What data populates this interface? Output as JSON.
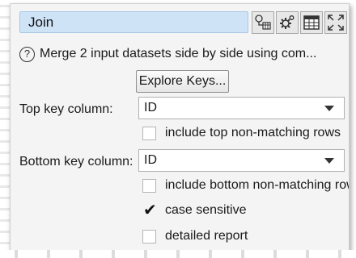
{
  "node": {
    "title": "Join",
    "description": "Merge 2 input datasets side by side using com...",
    "toolbar": {
      "icons": [
        "node-settings-icon",
        "gear-icon",
        "table-icon",
        "expand-icon"
      ]
    }
  },
  "explore_button": {
    "label": "Explore Keys..."
  },
  "top_key": {
    "label": "Top key column:",
    "value": "ID",
    "include_non_matching": {
      "label": "include top non-matching rows",
      "checked": false
    }
  },
  "bottom_key": {
    "label": "Bottom key column:",
    "value": "ID",
    "include_non_matching": {
      "label": "include bottom non-matching rows",
      "checked": false
    }
  },
  "case_sensitive": {
    "label": "case sensitive",
    "checked": true
  },
  "detailed_report": {
    "label": "detailed report",
    "checked": false
  },
  "colors": {
    "title_bg": "#cfe3f7",
    "panel_bg": "#f4f4f4"
  }
}
